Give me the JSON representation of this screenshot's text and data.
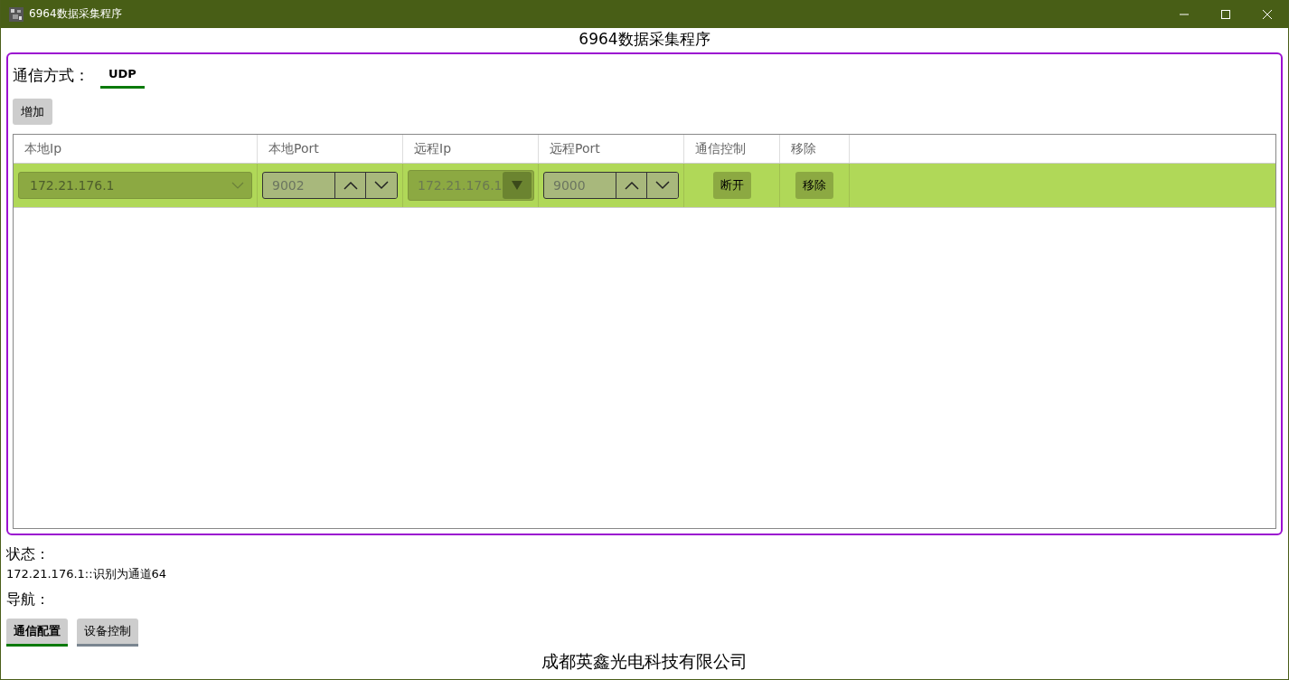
{
  "window": {
    "title": "6964数据采集程序"
  },
  "heading": "6964数据采集程序",
  "comm": {
    "label": "通信方式：",
    "tabs": [
      {
        "label": "UDP",
        "selected": true
      }
    ]
  },
  "add_button": "增加",
  "table": {
    "columns": [
      "本地Ip",
      "本地Port",
      "远程Ip",
      "远程Port",
      "通信控制",
      "移除"
    ],
    "rows": [
      {
        "selected": true,
        "local_ip": "172.21.176.1",
        "local_port": "9002",
        "remote_ip": "172.21.176.1",
        "remote_port": "9000",
        "control": "断开",
        "remove": "移除"
      }
    ]
  },
  "status": {
    "label": "状态：",
    "text": "172.21.176.1::识别为通道64"
  },
  "nav": {
    "label": "导航：",
    "buttons": [
      {
        "label": "通信配置",
        "selected": true
      },
      {
        "label": "设备控制",
        "selected": false
      }
    ]
  },
  "footer": "成都英鑫光电科技有限公司"
}
